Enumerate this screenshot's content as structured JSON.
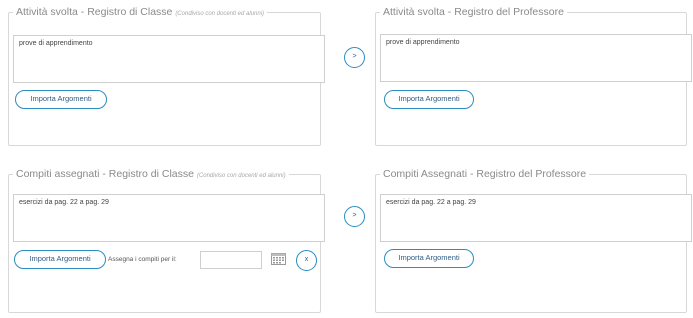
{
  "activity": {
    "class_register": {
      "legend": "Attività svolta - Registro di Classe",
      "legend_note": "(Condiviso con docenti ed alunni)",
      "text": "prove di apprendimento",
      "import_button": "Importa Argomenti"
    },
    "copy_button": ">",
    "teacher_register": {
      "legend": "Attività svolta - Registro del Professore",
      "text": "prove di apprendimento",
      "import_button": "Importa Argomenti"
    }
  },
  "homework": {
    "class_register": {
      "legend": "Compiti assegnati - Registro di Classe",
      "legend_note": "(Condiviso con docenti ed alunni)",
      "text": "esercizi da pag. 22 a pag. 29",
      "import_button": "Importa Argomenti",
      "assign_label": "Assegna i compiti per il:",
      "date_value": "",
      "clear_button": "x"
    },
    "copy_button": ">",
    "teacher_register": {
      "legend": "Compiti Assegnati - Registro del Professore",
      "text": "esercizi da pag. 22 a pag. 29",
      "import_button": "Importa Argomenti"
    }
  },
  "icons": {
    "calendar": "calendar-icon"
  }
}
